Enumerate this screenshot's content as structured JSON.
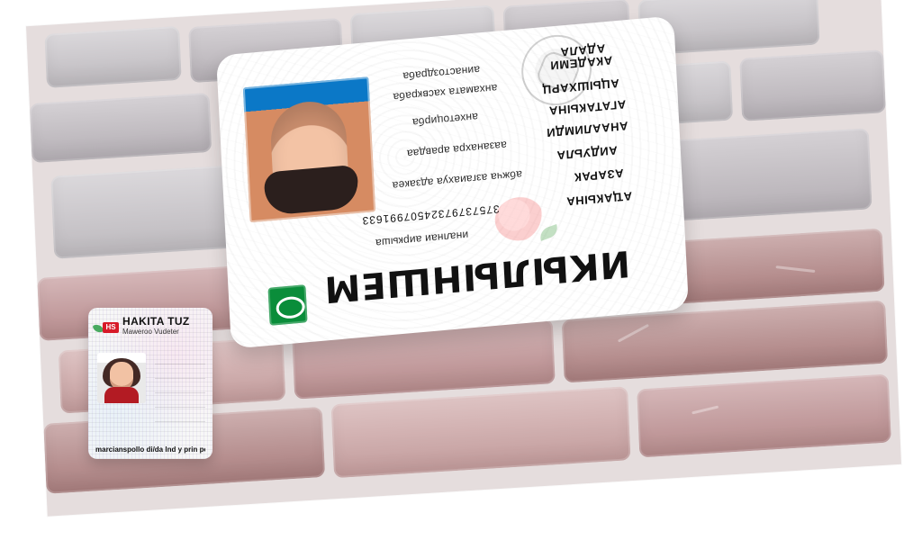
{
  "main_card": {
    "title_text": "ИКЫЛЫНШЕМ",
    "fields": {
      "right_1": "АДАЛА",
      "right_2": "АКАДЕМИ",
      "right_3": "АЦЫШХАРЦ",
      "right_4": "АГАТАКЫНА",
      "right_5": "АНААЛИМДИ",
      "right_6": "АИДУЬЛА",
      "right_7": "АЗАРАК",
      "right_8": "АҴАКЫНА",
      "left_1": "аинастоздраба",
      "left_2": "анхамата хасвкраба",
      "left_3": "анхетоцирба",
      "left_4": "аазанахра аравдаа",
      "left_5": "абжча азгаиахуа адзакеа",
      "digits": "37573797324507991633",
      "left_6": "иналнаи аиркыша"
    },
    "icons": {
      "green_logo": "green-oval-logo-icon"
    }
  },
  "small_card": {
    "name": "HAKITA TUZ",
    "subtitle": "Maweroo Vudeter",
    "badge": "HS",
    "footer": "marcianspollo di/da lnd y prin pollo"
  }
}
